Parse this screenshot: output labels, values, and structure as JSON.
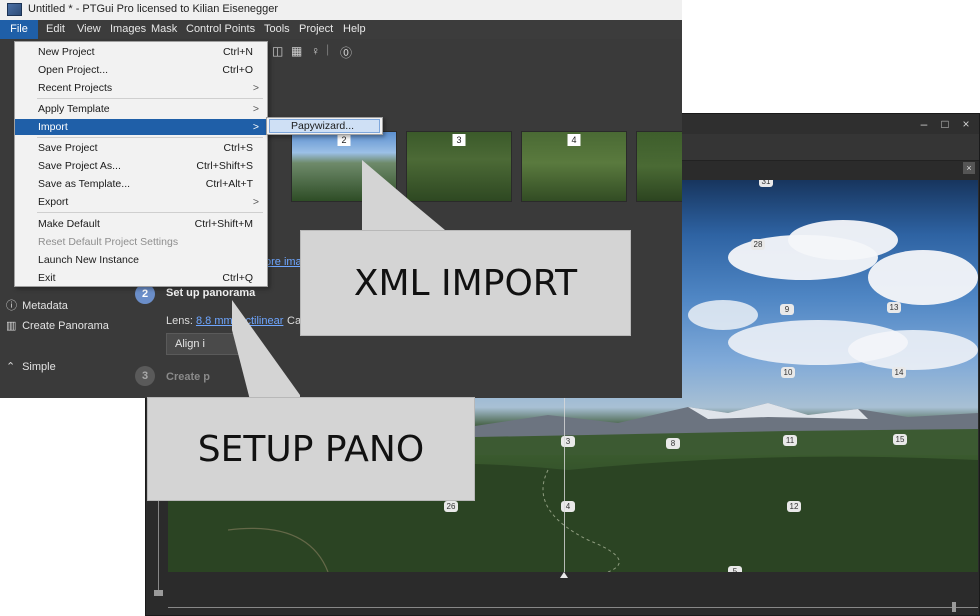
{
  "pano_window": {
    "controls": {
      "minimize": "–",
      "maximize": "□",
      "close": "×"
    },
    "close_tab": "×",
    "control_points": [
      "31",
      "28",
      "9",
      "13",
      "10",
      "14",
      "3",
      "8",
      "11",
      "15",
      "4",
      "26",
      "12",
      "5"
    ]
  },
  "main_window": {
    "title": "Untitled * - PTGui Pro licensed to Kilian Eisenegger",
    "menubar": [
      "File",
      "Edit",
      "View",
      "Images",
      "Mask",
      "Control Points",
      "Tools",
      "Project",
      "Help"
    ],
    "toolbar_icons": [
      "layers-icon",
      "grid-icon",
      "pin-icon",
      "help-icon"
    ],
    "sidebar": {
      "metadata": "Metadata",
      "create_panorama": "Create Panorama",
      "simple": "Simple"
    },
    "thumbnails": [
      "2",
      "3",
      "4"
    ],
    "more_images_link": "ore ima",
    "step2": {
      "number": "2",
      "title": "Set up panorama"
    },
    "lens": {
      "label": "Lens: ",
      "link": "8.8 mm rectilinear"
    },
    "camera_label": "Can",
    "align_button": "Align i",
    "step3": {
      "number": "3",
      "title": "Create p"
    }
  },
  "file_menu": {
    "items": [
      {
        "label": "New Project",
        "shortcut": "Ctrl+N"
      },
      {
        "label": "Open Project...",
        "shortcut": "Ctrl+O"
      },
      {
        "label": "Recent Projects",
        "arrow": ">"
      },
      {
        "label": "Apply Template",
        "arrow": ">"
      },
      {
        "label": "Import",
        "arrow": ">"
      },
      {
        "label": "Save Project",
        "shortcut": "Ctrl+S"
      },
      {
        "label": "Save Project As...",
        "shortcut": "Ctrl+Shift+S"
      },
      {
        "label": "Save as Template...",
        "shortcut": "Ctrl+Alt+T"
      },
      {
        "label": "Export",
        "arrow": ">"
      },
      {
        "label": "Make Default",
        "shortcut": "Ctrl+Shift+M"
      },
      {
        "label": "Reset Default Project Settings"
      },
      {
        "label": "Launch New Instance"
      },
      {
        "label": "Exit",
        "shortcut": "Ctrl+Q"
      }
    ],
    "import_submenu": [
      "Papywizard..."
    ]
  },
  "callouts": {
    "xml_import": "XML IMPORT",
    "setup_pano": "SETUP PANO"
  }
}
